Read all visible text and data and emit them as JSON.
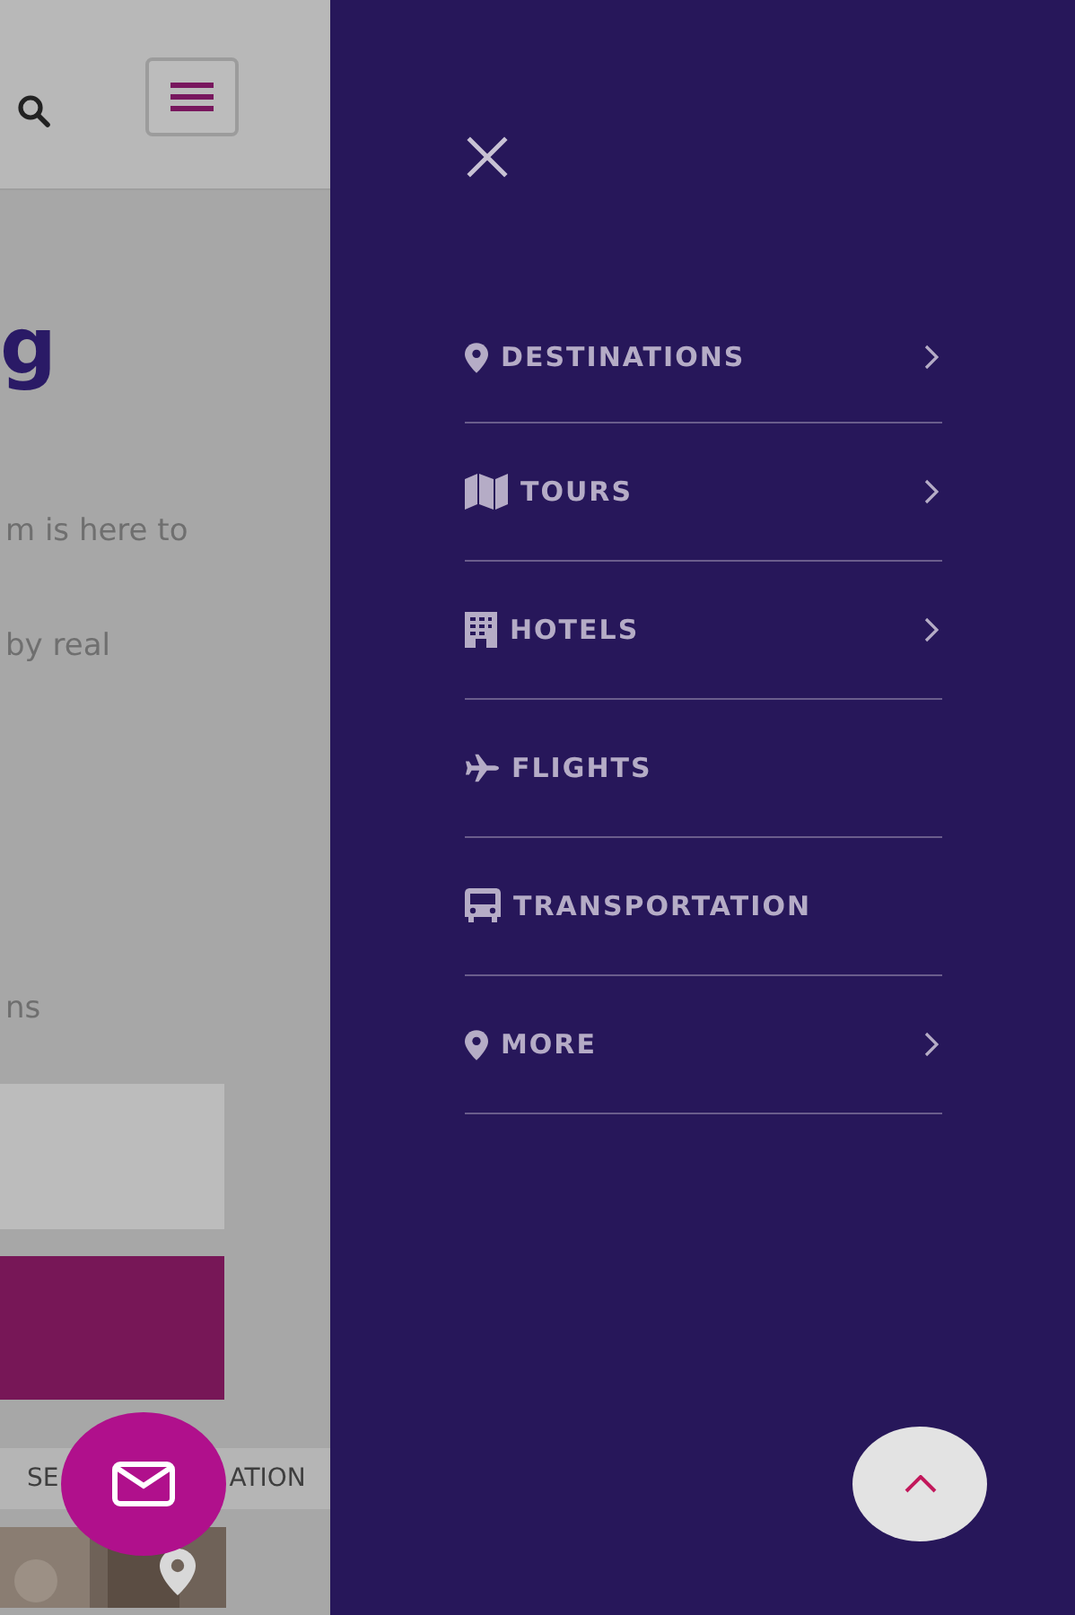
{
  "page": {
    "heading": "g",
    "paragraphs": [
      "m is here to",
      "by real",
      "ns"
    ],
    "tab_strip": [
      "SE",
      "ATION"
    ]
  },
  "drawer": {
    "items": [
      {
        "label": "DESTINATIONS",
        "kind": "pin",
        "has_submenu": true
      },
      {
        "label": "TOURS",
        "kind": "map",
        "has_submenu": true
      },
      {
        "label": "HOTELS",
        "kind": "building",
        "has_submenu": true
      },
      {
        "label": "FLIGHTS",
        "kind": "plane",
        "has_submenu": false
      },
      {
        "label": "TRANSPORTATION",
        "kind": "bus",
        "has_submenu": false
      },
      {
        "label": "MORE",
        "kind": "pin",
        "has_submenu": true
      }
    ]
  }
}
